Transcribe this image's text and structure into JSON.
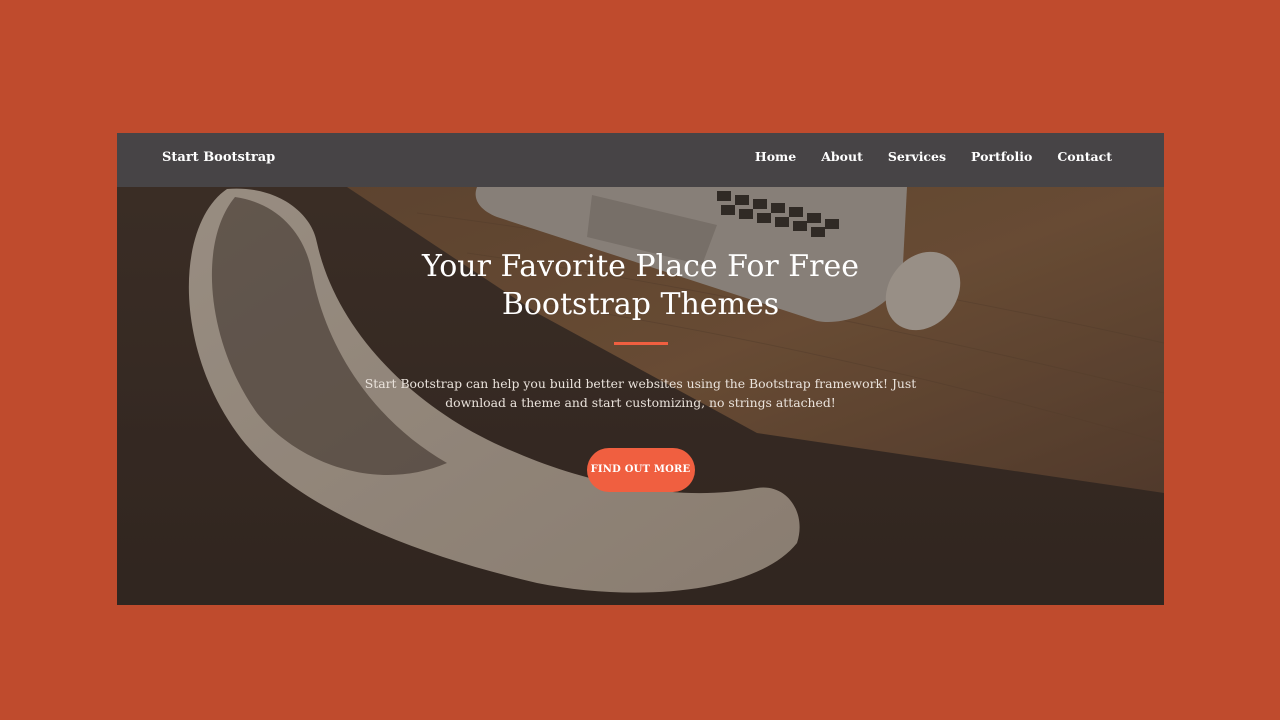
{
  "colors": {
    "backdrop": "#bf4b2d",
    "navbar": "#474446",
    "accent": "#f05f40",
    "text": "#ffffff"
  },
  "navbar": {
    "brand": "Start Bootstrap",
    "links": [
      "Home",
      "About",
      "Services",
      "Portfolio",
      "Contact"
    ]
  },
  "hero": {
    "title": "Your Favorite Place For Free Bootstrap Themes",
    "text": "Start Bootstrap can help you build better websites using the Bootstrap framework! Just download a theme and start customizing, no strings attached!",
    "button_label": "FIND OUT MORE",
    "background_image": "desk-with-laptop-mouse-and-chair-photo"
  }
}
